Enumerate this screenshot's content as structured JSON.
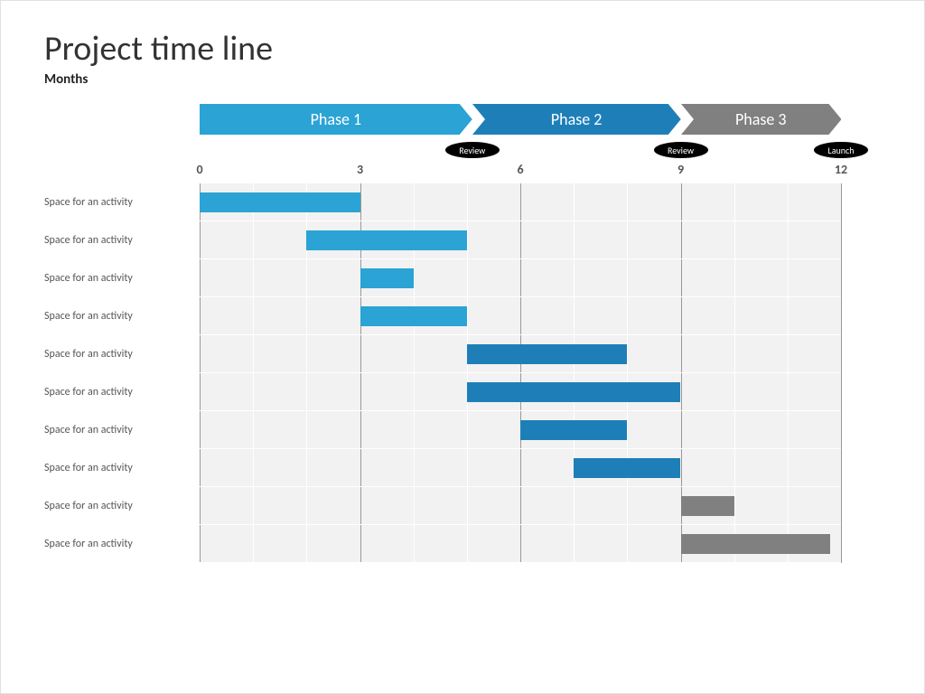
{
  "title": "Project time line",
  "subtitle": "Months",
  "chart_data": {
    "type": "bar",
    "xlabel": "Months",
    "xlim": [
      0,
      12
    ],
    "ticks": [
      0,
      3,
      6,
      9,
      12
    ],
    "phases": [
      {
        "label": "Phase 1",
        "start": 0,
        "end": 5.1,
        "color": "#2BA3D4"
      },
      {
        "label": "Phase 2",
        "start": 5.1,
        "end": 9.0,
        "color": "#1E7FB8"
      },
      {
        "label": "Phase 3",
        "start": 9.0,
        "end": 12.0,
        "color": "#808080"
      }
    ],
    "milestones": [
      {
        "label": "Review",
        "x": 5.1
      },
      {
        "label": "Review",
        "x": 9.0
      },
      {
        "label": "Launch",
        "x": 12.0
      }
    ],
    "activities": [
      {
        "label": "Space for an activity",
        "start": 0.0,
        "end": 3.0,
        "color": "#2BA3D4"
      },
      {
        "label": "Space for an activity",
        "start": 2.0,
        "end": 5.0,
        "color": "#2BA3D4"
      },
      {
        "label": "Space for an activity",
        "start": 3.0,
        "end": 4.0,
        "color": "#2BA3D4"
      },
      {
        "label": "Space for an activity",
        "start": 3.0,
        "end": 5.0,
        "color": "#2BA3D4"
      },
      {
        "label": "Space for an activity",
        "start": 5.0,
        "end": 8.0,
        "color": "#1E7FB8"
      },
      {
        "label": "Space for an activity",
        "start": 5.0,
        "end": 9.0,
        "color": "#1E7FB8"
      },
      {
        "label": "Space for an activity",
        "start": 6.0,
        "end": 8.0,
        "color": "#1E7FB8"
      },
      {
        "label": "Space for an activity",
        "start": 7.0,
        "end": 9.0,
        "color": "#1E7FB8"
      },
      {
        "label": "Space for an activity",
        "start": 9.0,
        "end": 10.0,
        "color": "#808080"
      },
      {
        "label": "Space for an activity",
        "start": 9.0,
        "end": 11.8,
        "color": "#808080"
      }
    ]
  }
}
